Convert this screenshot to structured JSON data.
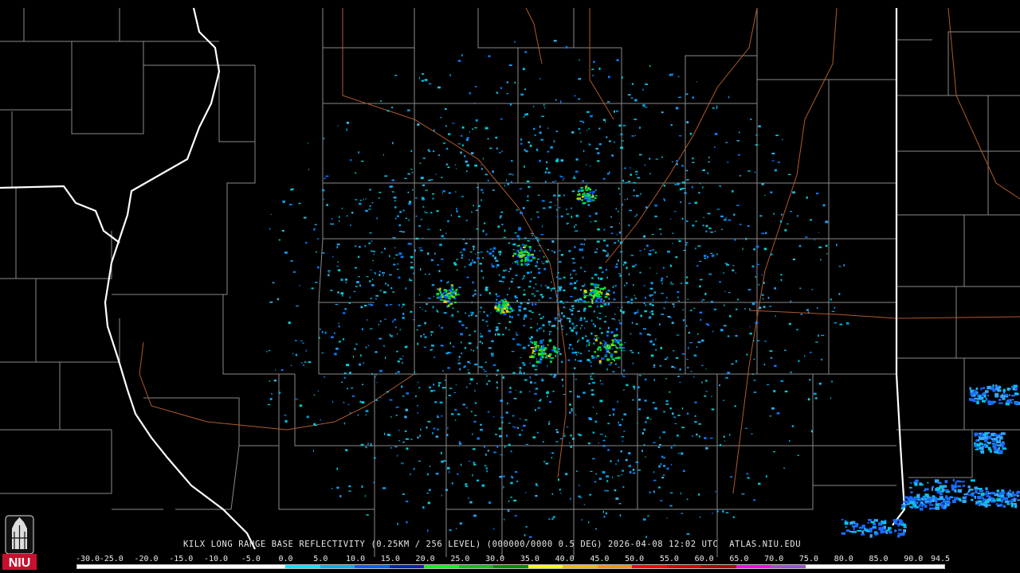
{
  "map": {
    "station": "KILX",
    "caption": "KILX LONG RANGE BASE REFLECTIVITY (0.25KM / 256 LEVEL) (000000/0000 0.5 DEG) 2026-04-08 12:02 UTC  ATLAS.NIU.EDU",
    "product": "Long Range Base Reflectivity",
    "elevation_deg": 0.5,
    "timestamp_utc": "2026-04-08 12:02",
    "source": "ATLAS.NIU.EDU"
  },
  "logo": {
    "text": "NIU",
    "icon": "niu-tower-logo",
    "color": "#c8102e"
  },
  "scale": {
    "labels": [
      "-30.0",
      "-25.0",
      "-20.0",
      "-15.0",
      "-10.0",
      "-5.0",
      "0.0",
      "5.0",
      "10.0",
      "15.0",
      "20.0",
      "25.0",
      "30.0",
      "35.0",
      "40.0",
      "45.0",
      "50.0",
      "55.0",
      "60.0",
      "65.0",
      "70.0",
      "75.0",
      "80.0",
      "85.0",
      "90.0",
      "94.5"
    ],
    "colors": [
      "#ffffff",
      "#ffffff",
      "#ffffff",
      "#ffffff",
      "#ffffff",
      "#ffffff",
      "#00e8ff",
      "#00b0ff",
      "#0060ff",
      "#0020c8",
      "#00ff00",
      "#00c800",
      "#008c00",
      "#ffff00",
      "#e8c000",
      "#ff9000",
      "#ff0000",
      "#d60000",
      "#b00000",
      "#ff00ff",
      "#9955cc",
      "#ffffff",
      "#ffffff",
      "#ffffff",
      "#ffffff"
    ]
  },
  "colors": {
    "background": "#000000",
    "county_lines": "#8a8a8a",
    "state_lines": "#ffffff",
    "rivers": "#b05a2a"
  }
}
